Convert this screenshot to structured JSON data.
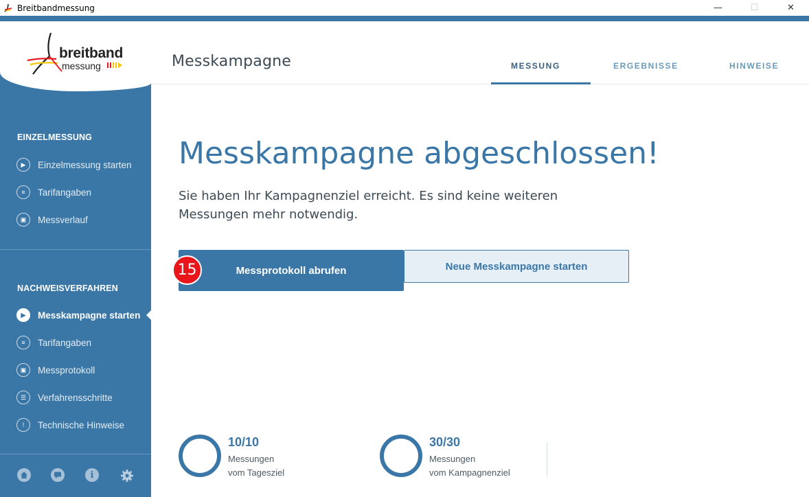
{
  "window": {
    "title": "Breitbandmessung",
    "minimize": "—",
    "maximize": "☐",
    "close": "✕"
  },
  "logo": {
    "line1": "breitband",
    "line2": "messung"
  },
  "sidebar": {
    "section1": {
      "title": "EINZELMESSUNG",
      "items": [
        {
          "label": "Einzelmessung starten",
          "icon": "play-icon"
        },
        {
          "label": "Tarifangaben",
          "icon": "user-card-icon"
        },
        {
          "label": "Messverlauf",
          "icon": "clipboard-icon"
        }
      ]
    },
    "section2": {
      "title": "NACHWEISVERFAHREN",
      "items": [
        {
          "label": "Messkampagne starten",
          "icon": "play-icon",
          "active": true
        },
        {
          "label": "Tarifangaben",
          "icon": "user-card-icon"
        },
        {
          "label": "Messprotokoll",
          "icon": "clipboard-icon"
        },
        {
          "label": "Verfahrensschritte",
          "icon": "list-icon"
        },
        {
          "label": "Technische Hinweise",
          "icon": "warning-icon"
        }
      ]
    },
    "footer": [
      "home-icon",
      "chat-icon",
      "info-icon",
      "gear-icon"
    ]
  },
  "header": {
    "title": "Messkampagne",
    "tabs": [
      {
        "label": "MESSUNG",
        "active": true
      },
      {
        "label": "ERGEBNISSE"
      },
      {
        "label": "HINWEISE"
      }
    ]
  },
  "main": {
    "heading": "Messkampagne abgeschlossen!",
    "description": "Sie haben Ihr Kampagnenziel erreicht. Es sind keine weiteren Messungen mehr notwendig.",
    "primary_button": "Messprotokoll abrufen",
    "secondary_button": "Neue Messkampagne starten",
    "step_badge": "15"
  },
  "stats": [
    {
      "value": "10/10",
      "line1": "Messungen",
      "line2": "vom Tagesziel"
    },
    {
      "value": "30/30",
      "line1": "Messungen",
      "line2": "vom Kampagnenziel"
    }
  ],
  "colors": {
    "primary": "#3a77a7",
    "badge": "#e8161b"
  }
}
